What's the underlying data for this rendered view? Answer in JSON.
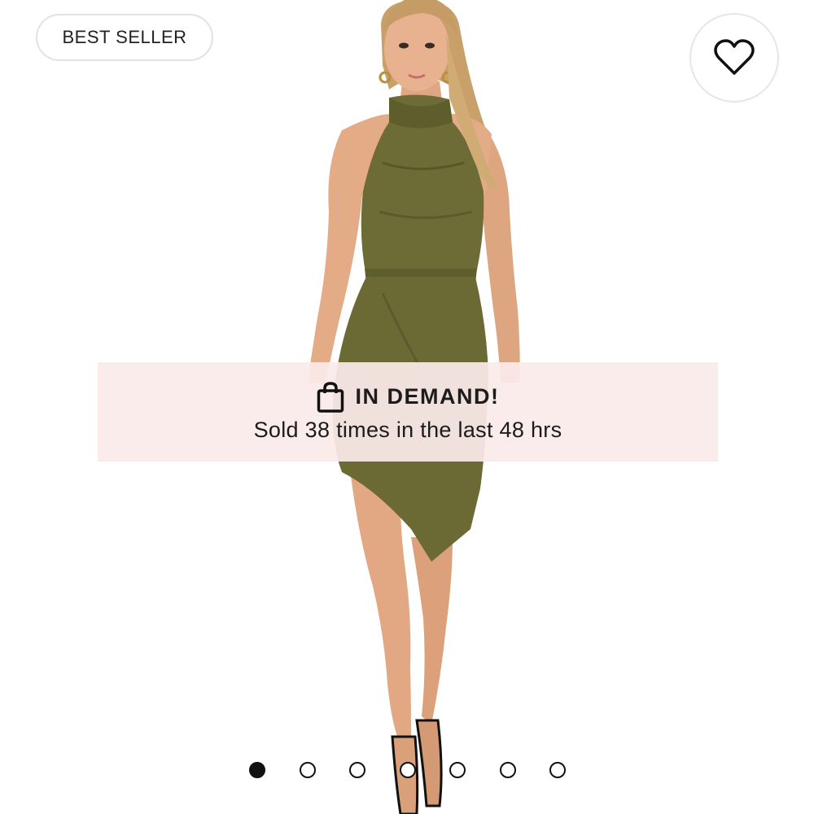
{
  "badge": {
    "label": "BEST SELLER"
  },
  "wishlist": {
    "icon": "heart-icon"
  },
  "banner": {
    "icon": "shopping-bag-icon",
    "title": "IN DEMAND!",
    "subtitle": "Sold 38 times in the last 48 hrs"
  },
  "carousel": {
    "total_slides": 7,
    "active_slide": 1
  },
  "colors": {
    "dress": "#6b6a35",
    "banner_bg": "#fbebeb",
    "text": "#1c1c1c"
  }
}
